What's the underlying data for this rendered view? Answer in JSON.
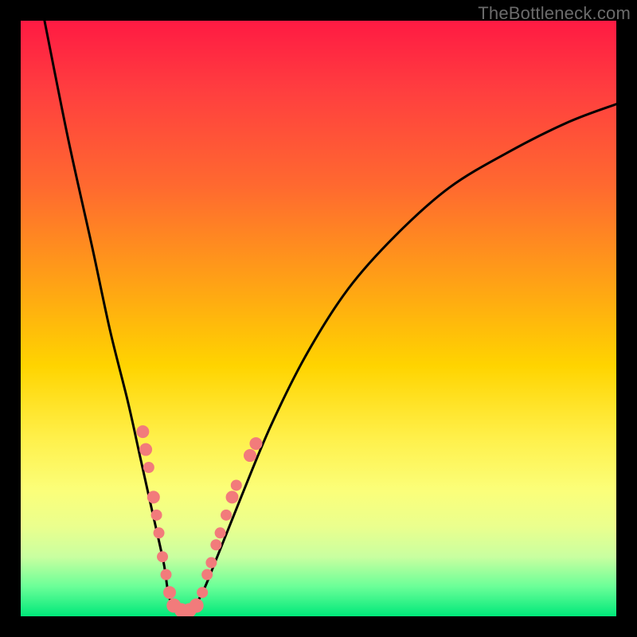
{
  "watermark": "TheBottleneck.com",
  "chart_data": {
    "type": "line",
    "title": "",
    "xlabel": "",
    "ylabel": "",
    "xlim": [
      0,
      100
    ],
    "ylim": [
      0,
      100
    ],
    "series": [
      {
        "name": "curve",
        "x": [
          4,
          8,
          12,
          15,
          18,
          20,
          22,
          24,
          25,
          27,
          30,
          33,
          37,
          42,
          48,
          55,
          63,
          72,
          82,
          92,
          100
        ],
        "y": [
          100,
          80,
          62,
          48,
          36,
          27,
          18,
          9,
          3,
          0,
          3,
          10,
          20,
          32,
          44,
          55,
          64,
          72,
          78,
          83,
          86
        ]
      }
    ],
    "markers": [
      {
        "x": 20.5,
        "y": 31,
        "r": 8
      },
      {
        "x": 21.0,
        "y": 28,
        "r": 8
      },
      {
        "x": 21.5,
        "y": 25,
        "r": 7
      },
      {
        "x": 22.3,
        "y": 20,
        "r": 8
      },
      {
        "x": 22.8,
        "y": 17,
        "r": 7
      },
      {
        "x": 23.2,
        "y": 14,
        "r": 7
      },
      {
        "x": 23.8,
        "y": 10,
        "r": 7
      },
      {
        "x": 24.4,
        "y": 7,
        "r": 7
      },
      {
        "x": 25.0,
        "y": 4,
        "r": 8
      },
      {
        "x": 25.7,
        "y": 1.8,
        "r": 9
      },
      {
        "x": 27.0,
        "y": 1.0,
        "r": 9
      },
      {
        "x": 28.3,
        "y": 1.0,
        "r": 9
      },
      {
        "x": 29.5,
        "y": 1.8,
        "r": 9
      },
      {
        "x": 30.5,
        "y": 4,
        "r": 7
      },
      {
        "x": 31.3,
        "y": 7,
        "r": 7
      },
      {
        "x": 32.0,
        "y": 9,
        "r": 7
      },
      {
        "x": 32.8,
        "y": 12,
        "r": 7
      },
      {
        "x": 33.5,
        "y": 14,
        "r": 7
      },
      {
        "x": 34.5,
        "y": 17,
        "r": 7
      },
      {
        "x": 35.5,
        "y": 20,
        "r": 8
      },
      {
        "x": 36.2,
        "y": 22,
        "r": 7
      },
      {
        "x": 38.5,
        "y": 27,
        "r": 8
      },
      {
        "x": 39.5,
        "y": 29,
        "r": 8
      }
    ],
    "marker_color": "#f27b7b",
    "curve_color": "#000000"
  }
}
